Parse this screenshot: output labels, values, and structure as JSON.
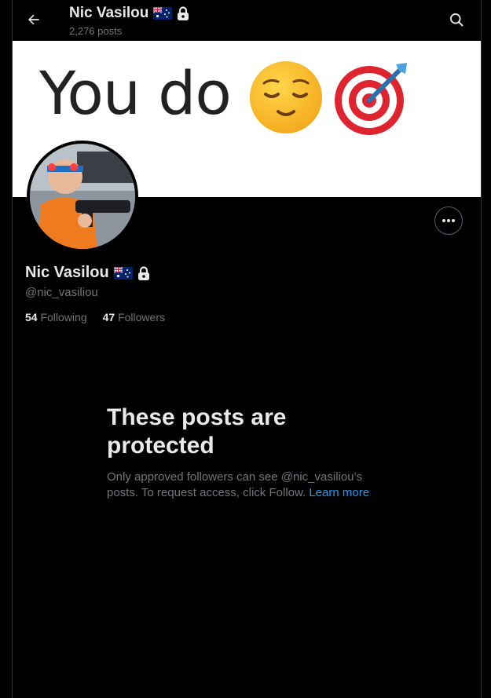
{
  "header": {
    "name": "Nic Vasilou",
    "posts_count": "2,276 posts"
  },
  "banner": {
    "text": "You do"
  },
  "profile": {
    "name": "Nic Vasilou",
    "handle": "@nic_vasiliou",
    "following_count": "54",
    "following_label": "Following",
    "followers_count": "47",
    "followers_label": "Followers"
  },
  "protected": {
    "title": "These posts are protected",
    "body": "Only approved followers can see @nic_vasiliou’s posts. To request access, click Follow.",
    "learn_more": "Learn more"
  },
  "icons": {
    "back": "arrow-left-icon",
    "search": "search-icon",
    "more": "more-dots-icon",
    "flag": "australia-flag-icon",
    "lock": "lock-icon",
    "relieved": "relieved-face-emoji",
    "target": "direct-hit-emoji"
  },
  "colors": {
    "background": "#000000",
    "text_primary": "#e7e9ea",
    "text_secondary": "#71767b",
    "link": "#1d9bf0"
  }
}
